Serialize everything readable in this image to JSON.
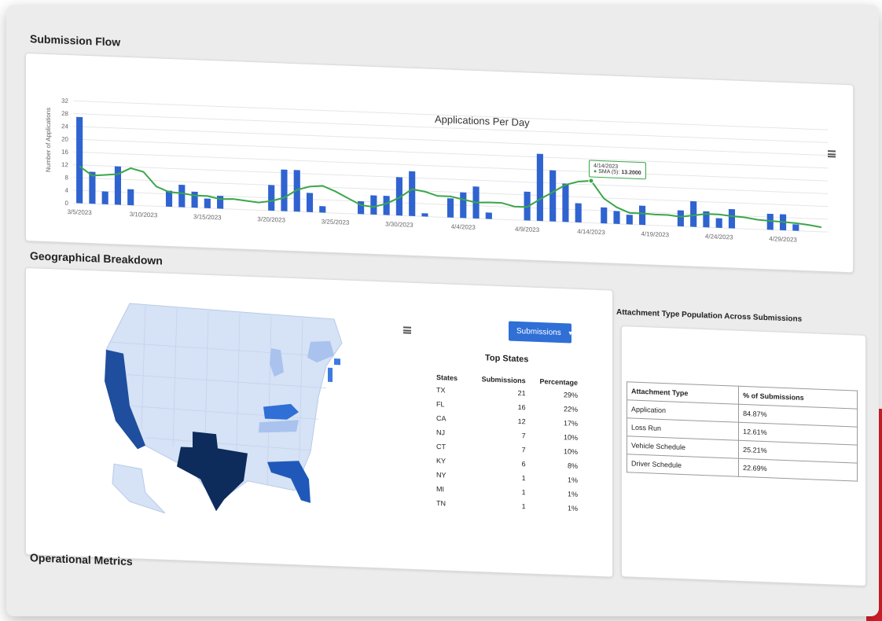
{
  "sections": {
    "submission_flow": "Submission Flow",
    "geographical": "Geographical Breakdown",
    "attachment_title": "Attachment Type Population Across Submissions",
    "operational": "Operational Metrics"
  },
  "chart_data": {
    "type": "bar",
    "title": "Applications Per Day",
    "ylabel": "Number of Applications",
    "ylim": [
      0,
      32
    ],
    "yticks": [
      0,
      4,
      8,
      12,
      16,
      20,
      24,
      28,
      32
    ],
    "xtick_labels": [
      "3/5/2023",
      "3/10/2023",
      "3/15/2023",
      "3/20/2023",
      "3/25/2023",
      "3/30/2023",
      "4/4/2023",
      "4/9/2023",
      "4/14/2023",
      "4/19/2023",
      "4/24/2023",
      "4/29/2023"
    ],
    "categories": [
      "3/5",
      "3/6",
      "3/7",
      "3/8",
      "3/9",
      "3/10",
      "3/11",
      "3/12",
      "3/13",
      "3/14",
      "3/15",
      "3/16",
      "3/17",
      "3/18",
      "3/19",
      "3/20",
      "3/21",
      "3/22",
      "3/23",
      "3/24",
      "3/25",
      "3/26",
      "3/27",
      "3/28",
      "3/29",
      "3/30",
      "3/31",
      "4/1",
      "4/2",
      "4/3",
      "4/4",
      "4/5",
      "4/6",
      "4/7",
      "4/8",
      "4/9",
      "4/10",
      "4/11",
      "4/12",
      "4/13",
      "4/14",
      "4/15",
      "4/16",
      "4/17",
      "4/18",
      "4/19",
      "4/20",
      "4/21",
      "4/22",
      "4/23",
      "4/24",
      "4/25",
      "4/26",
      "4/27",
      "4/28",
      "4/29",
      "4/30",
      "5/1",
      "5/2"
    ],
    "series": [
      {
        "name": "",
        "type": "bar",
        "values": [
          27,
          10,
          4,
          12,
          5,
          0,
          0,
          5,
          7,
          5,
          3,
          4,
          0,
          0,
          0,
          8,
          13,
          13,
          6,
          2,
          0,
          0,
          4,
          6,
          6,
          12,
          14,
          1,
          0,
          6,
          8,
          10,
          2,
          0,
          0,
          9,
          21,
          16,
          12,
          6,
          0,
          5,
          4,
          3,
          6,
          0,
          0,
          5,
          8,
          5,
          3,
          6,
          0,
          0,
          5,
          5,
          2,
          0,
          0
        ]
      },
      {
        "name": "SMA (5)",
        "type": "line",
        "values": [
          11.6,
          8.8,
          9.2,
          9.6,
          11.6,
          10.6,
          6.2,
          4.6,
          4.4,
          3.8,
          3.8,
          3.0,
          3.2,
          2.8,
          2.4,
          3.0,
          4.2,
          6.8,
          8.0,
          8.4,
          6.8,
          4.8,
          2.8,
          2.4,
          3.6,
          5.6,
          8.4,
          7.8,
          6.6,
          6.6,
          5.8,
          5.0,
          5.2,
          5.2,
          4.2,
          4.2,
          6.8,
          9.2,
          11.6,
          12.8,
          13.2,
          7.8,
          5.2,
          3.6,
          3.6,
          3.4,
          3.4,
          3.0,
          3.6,
          4.2,
          4.2,
          3.8,
          3.6,
          3.0,
          2.8,
          2.6,
          2.4,
          2.0,
          1.4
        ]
      }
    ],
    "tooltip": {
      "date": "4/14/2023",
      "series": "SMA (5):",
      "value": "13.2000"
    }
  },
  "map": {
    "highlight_colors": {
      "TX": "#0d2c5c",
      "CA": "#1f4e9e",
      "FL": "#1f58b8",
      "KY": "#2f6fd6",
      "NJ": "#3d7be0",
      "CT": "#3d7be0",
      "NY": "#a9c2ee",
      "MI": "#a9c2ee",
      "TN": "#a9c2ee",
      "base": "#d6e2f5"
    }
  },
  "dropdown": {
    "label": "Submissions"
  },
  "top_states": {
    "title": "Top States",
    "headers": [
      "States",
      "Submissions",
      "Percentage"
    ],
    "rows": [
      [
        "TX",
        "21",
        "29%"
      ],
      [
        "FL",
        "16",
        "22%"
      ],
      [
        "CA",
        "12",
        "17%"
      ],
      [
        "NJ",
        "7",
        "10%"
      ],
      [
        "CT",
        "7",
        "10%"
      ],
      [
        "KY",
        "6",
        "8%"
      ],
      [
        "NY",
        "1",
        "1%"
      ],
      [
        "MI",
        "1",
        "1%"
      ],
      [
        "TN",
        "1",
        "1%"
      ]
    ]
  },
  "attachment": {
    "headers": [
      "Attachment Type",
      "% of Submissions"
    ],
    "rows": [
      [
        "Application",
        "84.87%"
      ],
      [
        "Loss Run",
        "12.61%"
      ],
      [
        "Vehicle Schedule",
        "25.21%"
      ],
      [
        "Driver Schedule",
        "22.69%"
      ]
    ]
  },
  "colors": {
    "bar": "#2f63d0",
    "sma": "#3aa64a",
    "trend": "#f2b8a8"
  }
}
